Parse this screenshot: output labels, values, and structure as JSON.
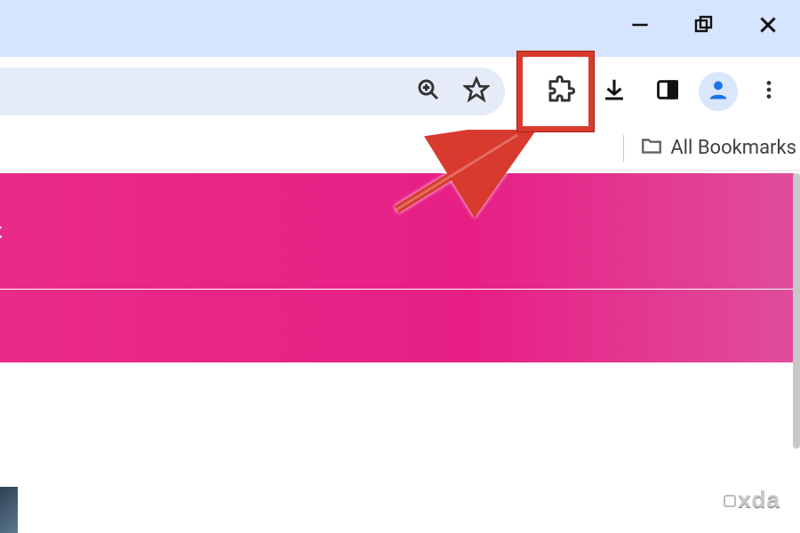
{
  "window_controls": {
    "minimize": "minimize",
    "maximize": "maximize",
    "close": "close"
  },
  "address_bar": {
    "zoom_icon": "zoom-in",
    "bookmark_icon": "star"
  },
  "toolbar": {
    "extensions_icon": "extensions",
    "downloads_icon": "downloads",
    "side_panel_icon": "side-panel",
    "profile_icon": "profile",
    "menu_icon": "more-vert"
  },
  "bookmarks_bar": {
    "all_bookmarks_label": "All Bookmarks"
  },
  "page": {
    "band1_text": "t"
  },
  "annotation": {
    "highlight_target": "extensions-button",
    "highlight_color": "#d93a2e",
    "arrow_color": "#d93a2e"
  },
  "watermark": {
    "text": "xda"
  }
}
